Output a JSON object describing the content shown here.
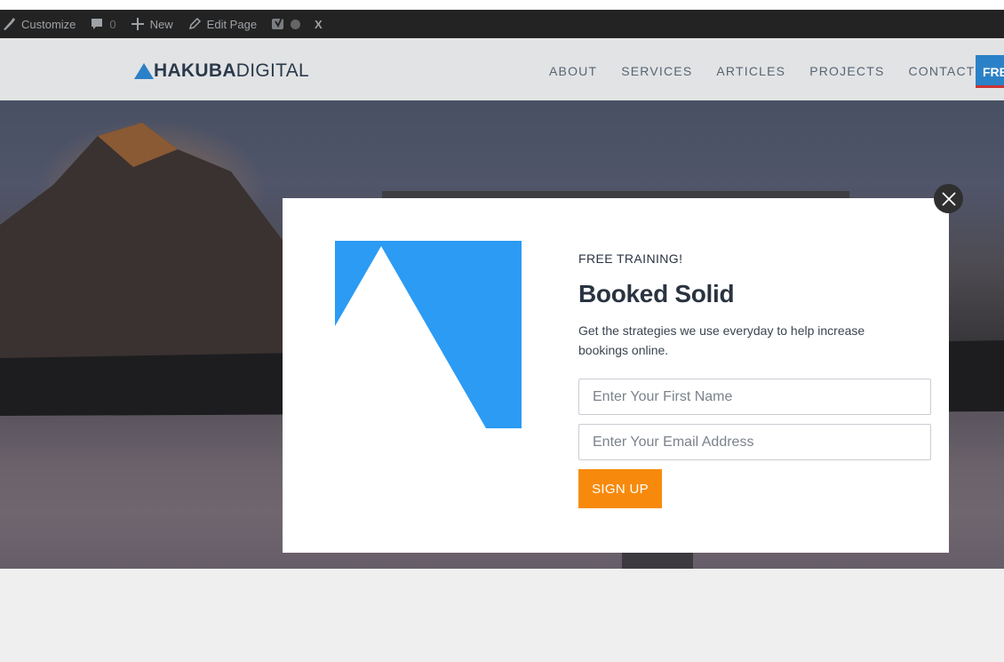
{
  "adminbar": {
    "customize_label": "Customize",
    "comments_count": "0",
    "new_label": "New",
    "edit_label": "Edit Page",
    "x_label": "X"
  },
  "header": {
    "logo_bold": "HAKUBA",
    "logo_light": "DIGITAL",
    "nav": [
      "ABOUT",
      "SERVICES",
      "ARTICLES",
      "PROJECTS",
      "CONTACT"
    ],
    "cta_label": "FRE"
  },
  "popup": {
    "eyebrow": "FREE TRAINING!",
    "title": "Booked Solid",
    "description": "Get the strategies we use everyday to help increase bookings online.",
    "first_name_placeholder": "Enter Your First Name",
    "email_placeholder": "Enter Your Email Address",
    "signup_label": "SIGN UP"
  },
  "colors": {
    "brand_blue": "#2b9bf4",
    "signup_orange": "#f78a0c",
    "admin_bar": "#232323"
  },
  "icons": [
    "brush-icon",
    "comment-icon",
    "plus-icon",
    "pencil-icon",
    "yoast-icon",
    "status-dot-icon",
    "close-icon",
    "mountain-logo-icon"
  ]
}
